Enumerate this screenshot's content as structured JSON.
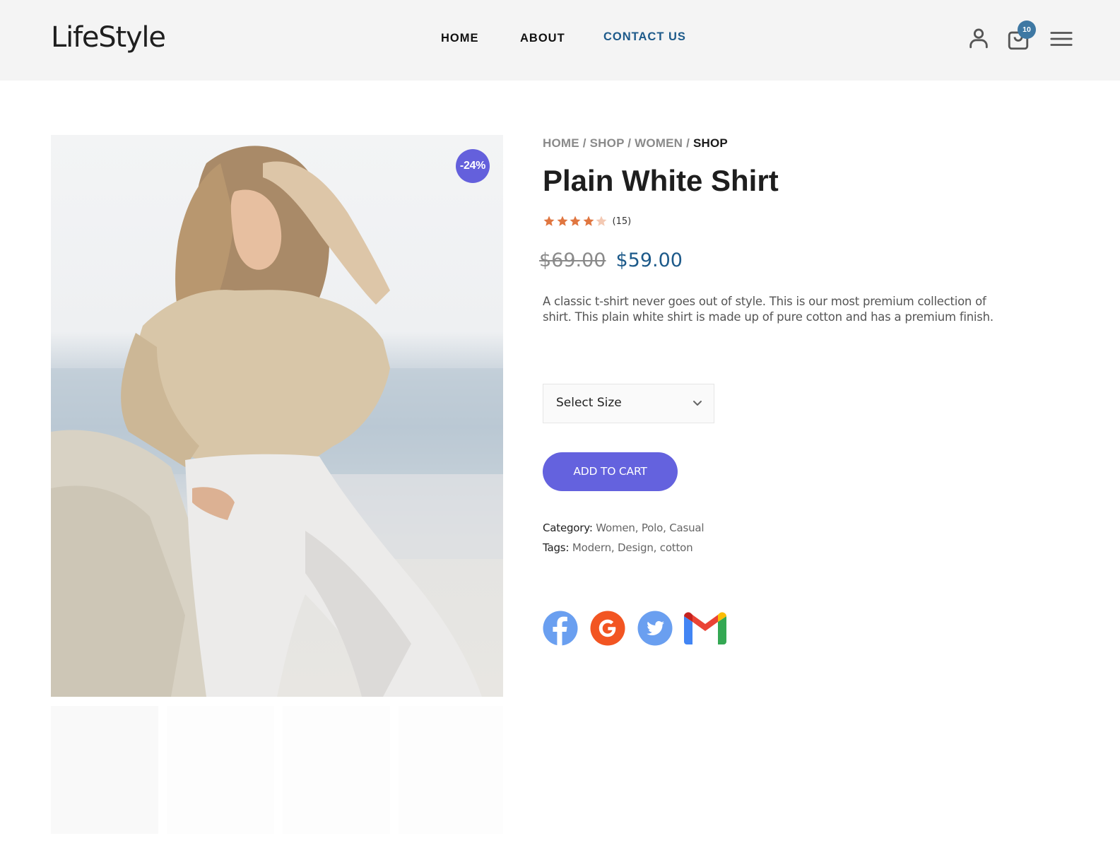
{
  "header": {
    "logo": "LifeStyle",
    "nav": [
      {
        "label": "HOME",
        "active": false
      },
      {
        "label": "ABOUT",
        "active": false
      },
      {
        "label": "CONTACT US",
        "active": true
      }
    ],
    "icons": [
      "user-icon",
      "shopping-bag-icon",
      "hamburger-menu-icon"
    ],
    "cart_count": "10",
    "colors": {
      "active_nav": "#1d5a8a",
      "cart_badge": "#3e78a3"
    }
  },
  "gallery": {
    "discount_badge": "-24%",
    "main_image": "woman-in-beige-blouse-white-pants-photo",
    "thumbnails_count": 4
  },
  "product": {
    "breadcrumb": [
      {
        "label": "HOME"
      },
      {
        "label": "SHOP"
      },
      {
        "label": "WOMEN"
      },
      {
        "label": "SHOP",
        "current": true
      }
    ],
    "breadcrumb_separator": "/",
    "title": "Plain White Shirt",
    "rating": {
      "value": 4,
      "max": 5,
      "count_label": "(15)"
    },
    "old_price": "$69.00",
    "price": "$59.00",
    "description": "A classic t-shirt never goes out of style. This is our most premium collection of shirt. This plain white shirt is made up of pure cotton and has a premium finish.",
    "size_select": {
      "selected": "Select Size"
    },
    "add_to_cart_label": "ADD TO CART",
    "category": {
      "label": "Category",
      "value": "Women, Polo, Casual"
    },
    "tags": {
      "label": "Tags",
      "value": "Modern, Design, cotton"
    },
    "share": [
      "facebook-icon",
      "google-icon",
      "twitter-icon",
      "gmail-icon"
    ],
    "colors": {
      "accent": "#6462de",
      "price": "#1d5a8a",
      "star": "#e07640",
      "star_empty": "#f3c9b3"
    }
  }
}
